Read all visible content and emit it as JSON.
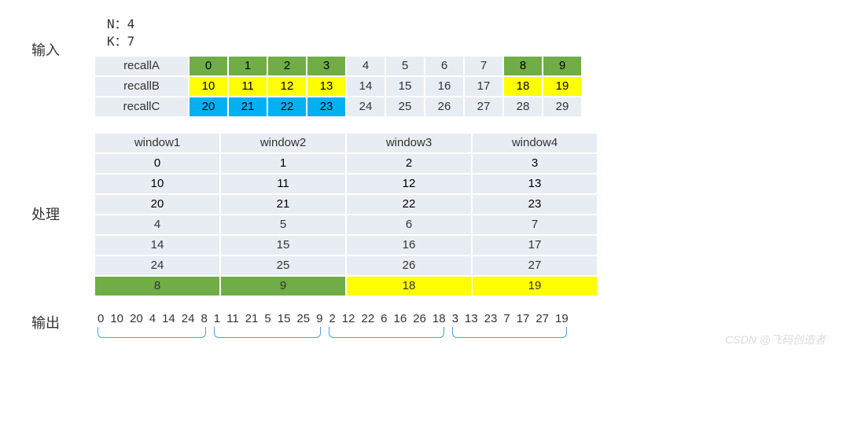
{
  "labels": {
    "input": "输入",
    "process": "处理",
    "output": "输出"
  },
  "params": {
    "N_label": "N：",
    "N_value": "4",
    "K_label": "K：",
    "K_value": "7"
  },
  "input_rows": [
    {
      "label": "recallA",
      "cells": [
        {
          "v": "0",
          "c": "green"
        },
        {
          "v": "1",
          "c": "green"
        },
        {
          "v": "2",
          "c": "green"
        },
        {
          "v": "3",
          "c": "green"
        },
        {
          "v": "4",
          "c": ""
        },
        {
          "v": "5",
          "c": ""
        },
        {
          "v": "6",
          "c": ""
        },
        {
          "v": "7",
          "c": ""
        },
        {
          "v": "8",
          "c": "green"
        },
        {
          "v": "9",
          "c": "green"
        }
      ]
    },
    {
      "label": "recallB",
      "cells": [
        {
          "v": "10",
          "c": "yellow"
        },
        {
          "v": "11",
          "c": "yellow"
        },
        {
          "v": "12",
          "c": "yellow"
        },
        {
          "v": "13",
          "c": "yellow"
        },
        {
          "v": "14",
          "c": ""
        },
        {
          "v": "15",
          "c": ""
        },
        {
          "v": "16",
          "c": ""
        },
        {
          "v": "17",
          "c": ""
        },
        {
          "v": "18",
          "c": "yellow"
        },
        {
          "v": "19",
          "c": "yellow"
        }
      ]
    },
    {
      "label": "recallC",
      "cells": [
        {
          "v": "20",
          "c": "blue"
        },
        {
          "v": "21",
          "c": "blue"
        },
        {
          "v": "22",
          "c": "blue"
        },
        {
          "v": "23",
          "c": "blue"
        },
        {
          "v": "24",
          "c": ""
        },
        {
          "v": "25",
          "c": ""
        },
        {
          "v": "26",
          "c": ""
        },
        {
          "v": "27",
          "c": ""
        },
        {
          "v": "28",
          "c": ""
        },
        {
          "v": "29",
          "c": ""
        }
      ]
    }
  ],
  "process": {
    "headers": [
      "window1",
      "window2",
      "window3",
      "window4"
    ],
    "rows": [
      {
        "c": "green",
        "v": [
          "0",
          "1",
          "2",
          "3"
        ]
      },
      {
        "c": "yellow",
        "v": [
          "10",
          "11",
          "12",
          "13"
        ]
      },
      {
        "c": "blue",
        "v": [
          "20",
          "21",
          "22",
          "23"
        ]
      },
      {
        "c": "",
        "v": [
          "4",
          "5",
          "6",
          "7"
        ]
      },
      {
        "c": "",
        "v": [
          "14",
          "15",
          "16",
          "17"
        ]
      },
      {
        "c": "",
        "v": [
          "24",
          "25",
          "26",
          "27"
        ]
      },
      {
        "c": "last",
        "v": [
          "8",
          "9",
          "18",
          "19"
        ]
      }
    ]
  },
  "output_groups": [
    [
      "0",
      "10",
      "20",
      "4",
      "14",
      "24",
      "8"
    ],
    [
      "1",
      "11",
      "21",
      "5",
      "15",
      "25",
      "9"
    ],
    [
      "2",
      "12",
      "22",
      "6",
      "16",
      "26",
      "18"
    ],
    [
      "3",
      "13",
      "23",
      "7",
      "17",
      "27",
      "19"
    ]
  ],
  "watermark": "CSDN @飞码创造者"
}
